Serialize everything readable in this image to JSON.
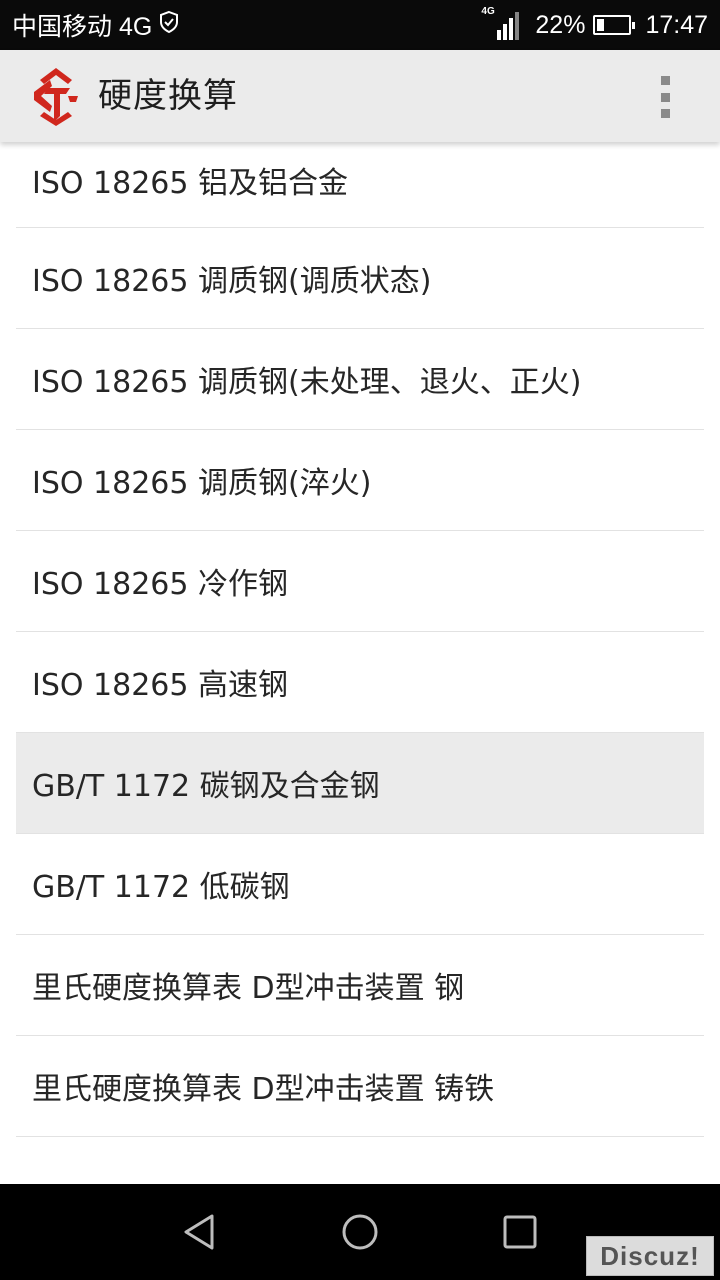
{
  "status_bar": {
    "carrier": "中国移动 4G",
    "network_badge": "4G",
    "battery_percent": "22%",
    "battery_level": 0.22,
    "time": "17:47",
    "icons": [
      "shield-icon",
      "signal-icon",
      "battery-icon"
    ]
  },
  "app_bar": {
    "title": "硬度换算",
    "logo_icon": "app-logo-icon",
    "menu_icon": "overflow-menu-icon",
    "brand_color": "#d0271d"
  },
  "list": {
    "items": [
      {
        "label": "ISO 18265 铝及铝合金"
      },
      {
        "label": "ISO 18265 调质钢(调质状态)"
      },
      {
        "label": "ISO 18265 调质钢(未处理、退火、正火)"
      },
      {
        "label": "ISO 18265 调质钢(淬火)"
      },
      {
        "label": "ISO 18265 冷作钢"
      },
      {
        "label": "ISO 18265 高速钢"
      },
      {
        "label": "GB/T 1172 碳钢及合金钢",
        "selected": true
      },
      {
        "label": "GB/T 1172 低碳钢"
      },
      {
        "label": "里氏硬度换算表 D型冲击装置 钢"
      },
      {
        "label": "里氏硬度换算表 D型冲击装置 铸铁"
      }
    ]
  },
  "nav_bar": {
    "icons": [
      "back-icon",
      "home-icon",
      "recent-apps-icon"
    ]
  },
  "watermark": {
    "text": "Discuz!"
  }
}
